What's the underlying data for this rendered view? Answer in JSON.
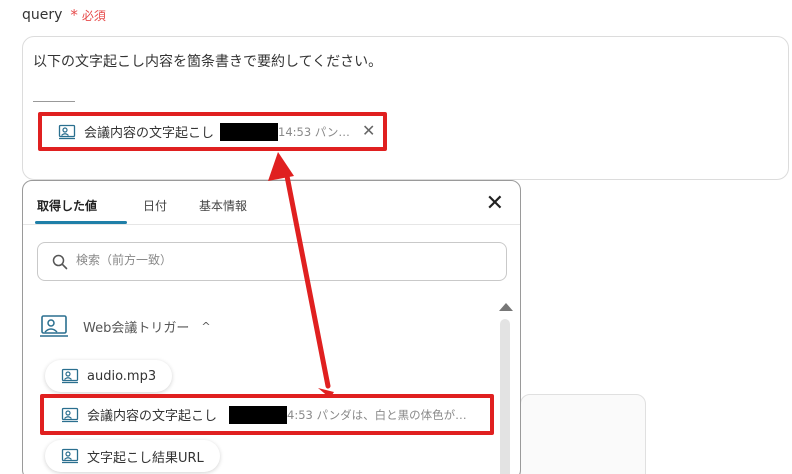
{
  "field": {
    "name": "query",
    "required_star": "*",
    "required_text": "必須"
  },
  "query_box": {
    "text": "以下の文字起こし内容を箇条書きで要約してください。",
    "token": {
      "label": "会議内容の文字起こし",
      "preview": "14:53 パン…"
    }
  },
  "popup": {
    "tabs": [
      {
        "label": "取得した値",
        "active": true
      },
      {
        "label": "日付",
        "active": false
      },
      {
        "label": "基本情報",
        "active": false
      }
    ],
    "close_glyph": "✕",
    "search_placeholder": "検索（前方一致）",
    "section": {
      "label": "Web会議トリガー",
      "chevron": "^"
    },
    "items": [
      {
        "label": "audio.mp3",
        "preview": ""
      },
      {
        "label": "会議内容の文字起こし",
        "preview": "4:53 パンダは、白と黒の体色が…"
      },
      {
        "label": "文字起こし結果URL",
        "preview": ""
      }
    ]
  },
  "colors": {
    "highlight": "#e02020",
    "accent": "#1f7fa8",
    "required": "#e74c4c"
  },
  "icons": {
    "token": "meeting-transcript-icon",
    "section": "web-meeting-icon",
    "search": "search-icon",
    "close": "close-icon",
    "arrow": "double-headed-arrow"
  }
}
